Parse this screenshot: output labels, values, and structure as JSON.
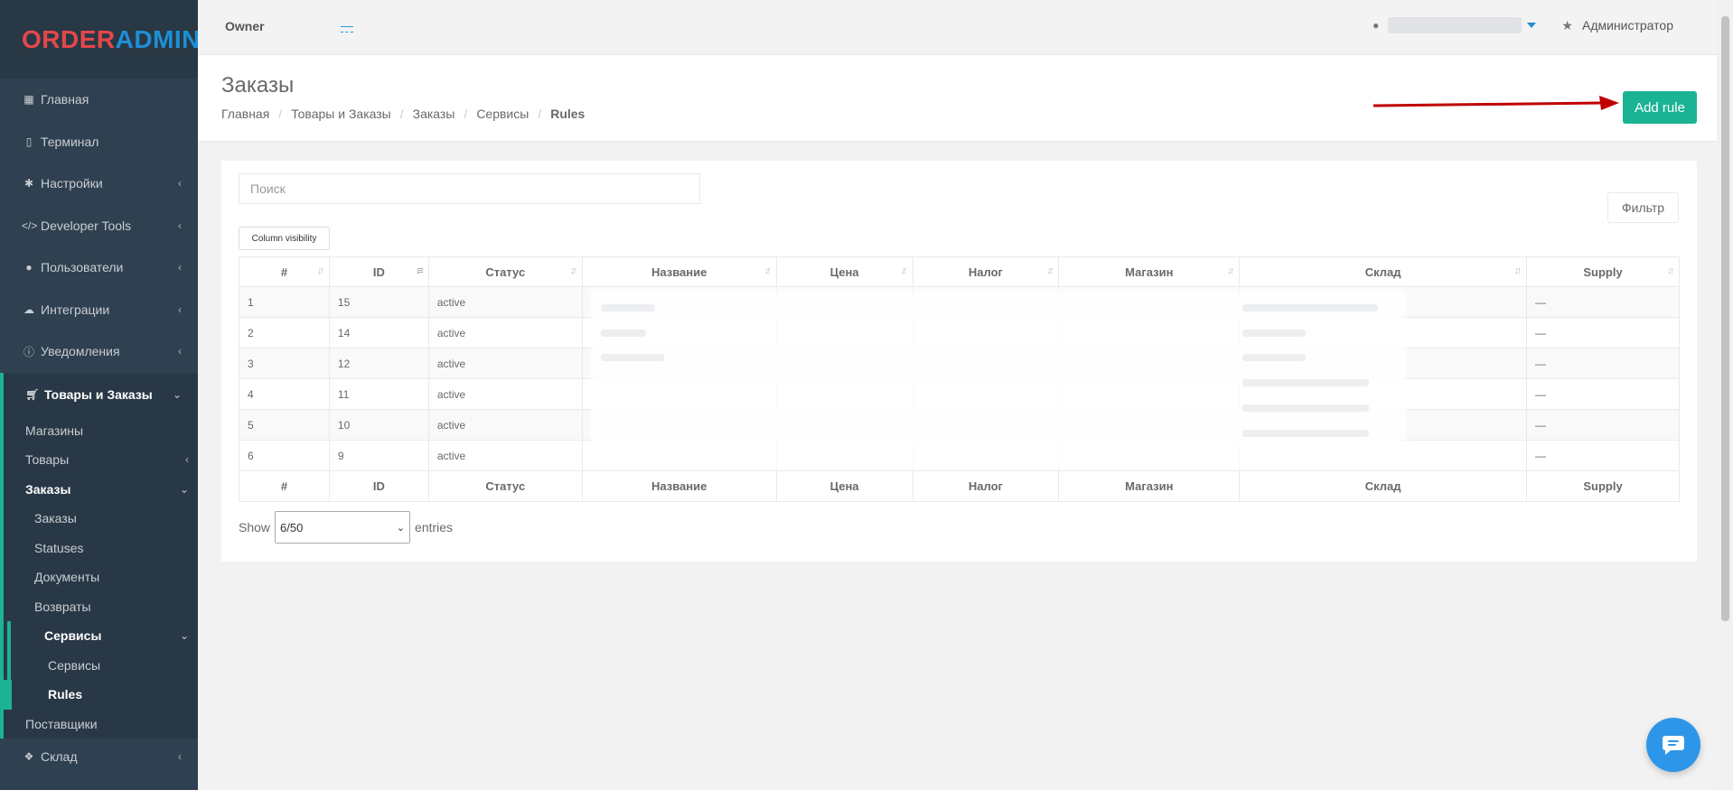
{
  "logo": {
    "part1": "ORDER",
    "part2": "ADMIN"
  },
  "sidebar": {
    "items": [
      {
        "label": "Главная",
        "icon": "grid-icon"
      },
      {
        "label": "Терминал",
        "icon": "tablet-icon"
      },
      {
        "label": "Настройки",
        "icon": "gear-icon"
      },
      {
        "label": "Developer Tools",
        "icon": "code-icon"
      },
      {
        "label": "Пользователи",
        "icon": "user-icon"
      },
      {
        "label": "Интеграции",
        "icon": "cloud-icon"
      },
      {
        "label": "Уведомления",
        "icon": "info-icon"
      }
    ],
    "group": {
      "label": "Товары и Заказы",
      "icon": "cart-icon",
      "children": {
        "shops": "Магазины",
        "goods": "Товары",
        "orders": "Заказы",
        "orders_children": {
          "orders": "Заказы",
          "statuses": "Statuses",
          "documents": "Документы",
          "returns": "Возвраты",
          "services": "Сервисы",
          "services_children": {
            "services": "Сервисы",
            "rules": "Rules"
          }
        },
        "suppliers": "Поставщики"
      }
    },
    "warehouse": {
      "label": "Склад",
      "icon": "cubes-icon"
    }
  },
  "topbar": {
    "owner_label": "Owner",
    "owner_value": "—",
    "role": "Администратор"
  },
  "heading": {
    "title": "Заказы",
    "breadcrumbs": [
      "Главная",
      "Товары и Заказы",
      "Заказы",
      "Сервисы",
      "Rules"
    ],
    "add_rule": "Add rule"
  },
  "panel": {
    "search_placeholder": "Поиск",
    "filter_label": "Фильтр",
    "column_visibility": "Column visibility",
    "columns": [
      "#",
      "ID",
      "Статус",
      "Название",
      "Цена",
      "Налог",
      "Магазин",
      "Склад",
      "Supply"
    ],
    "rows": [
      {
        "n": "1",
        "id": "15",
        "status": "active",
        "supply": "—"
      },
      {
        "n": "2",
        "id": "14",
        "status": "active",
        "supply": "—"
      },
      {
        "n": "3",
        "id": "12",
        "status": "active",
        "supply": "—"
      },
      {
        "n": "4",
        "id": "11",
        "status": "active",
        "supply": "—"
      },
      {
        "n": "5",
        "id": "10",
        "status": "active",
        "supply": "—"
      },
      {
        "n": "6",
        "id": "9",
        "status": "active",
        "supply": "—"
      }
    ],
    "show_label": "Show",
    "entries_select": "6/50",
    "entries_label": "entries"
  },
  "colors": {
    "accent": "#1ab394",
    "sidebar_bg": "#2f4050",
    "link": "#1e8fd6",
    "arrow": "#c00000"
  }
}
